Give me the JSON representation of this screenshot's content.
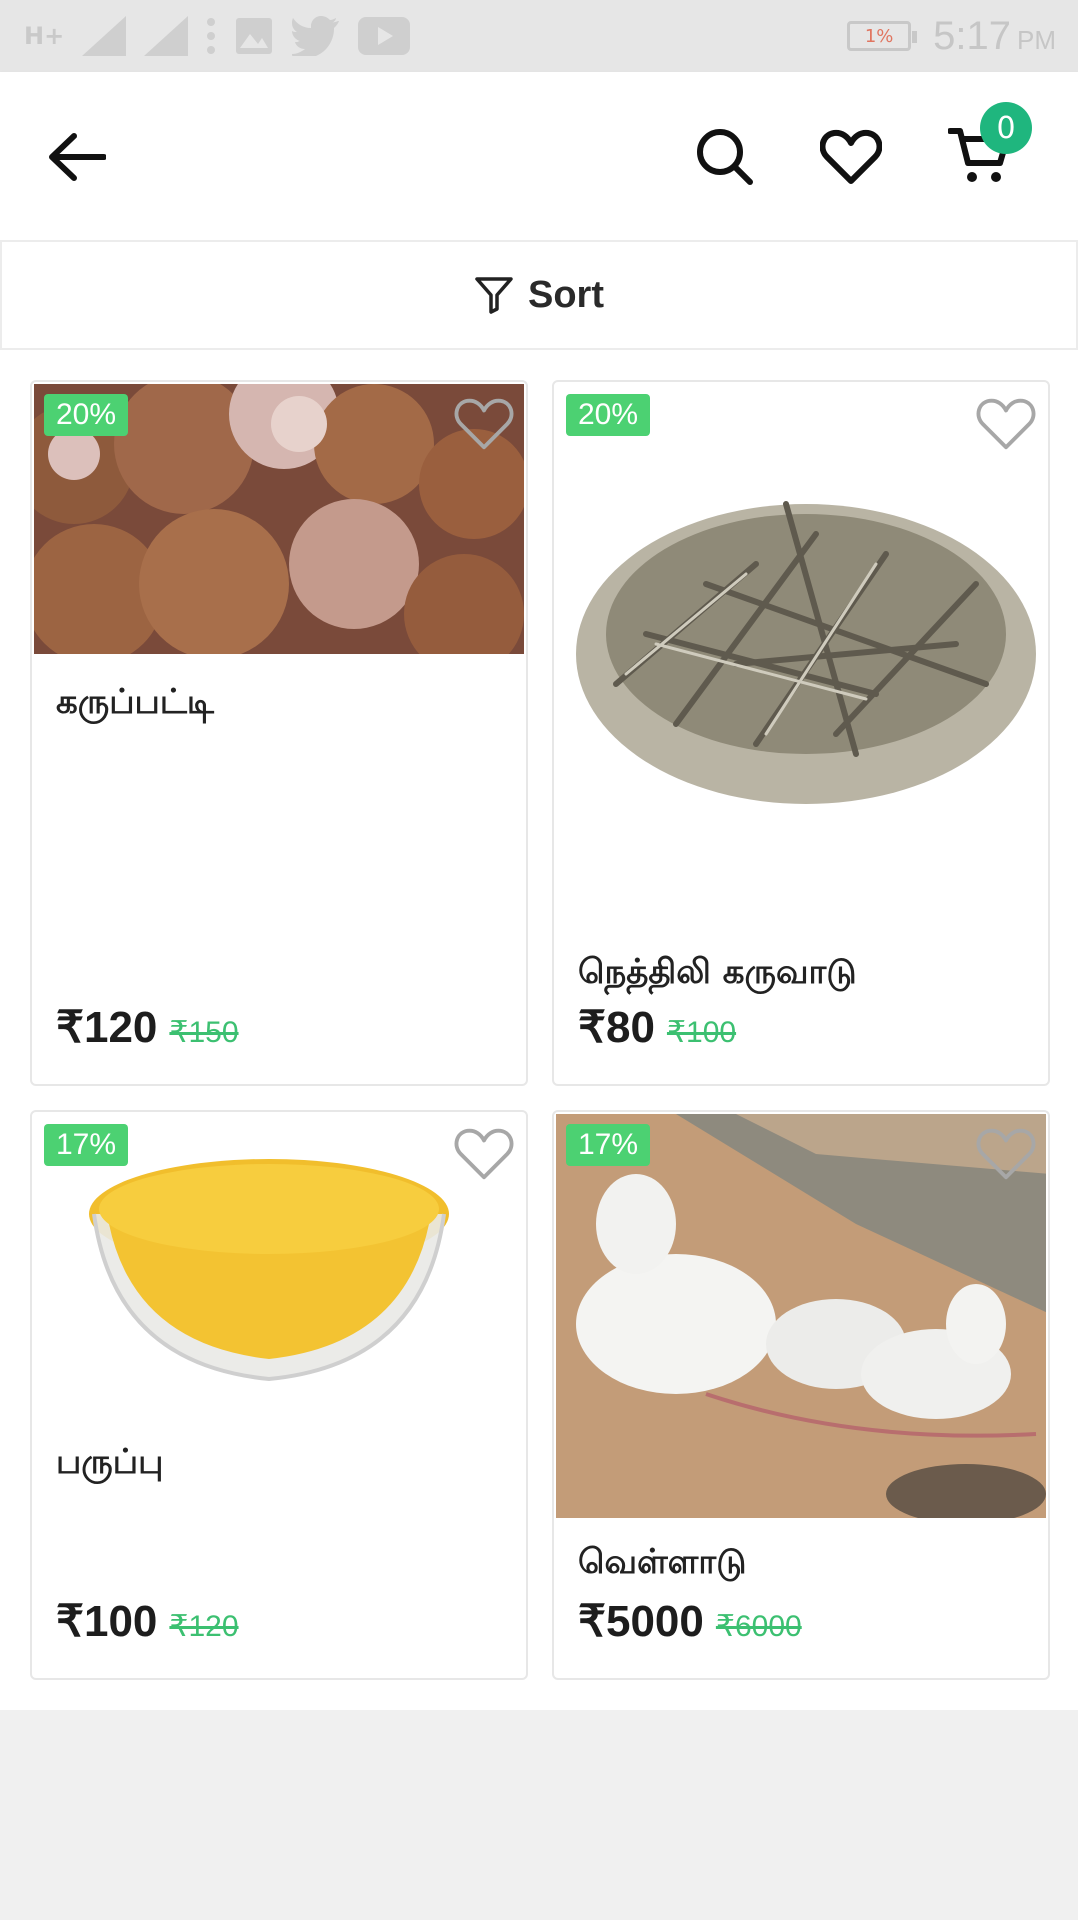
{
  "status_bar": {
    "network": "H+",
    "battery": "1%",
    "time": "5:17",
    "ampm": "PM"
  },
  "header": {
    "cart_count": "0"
  },
  "sort": {
    "label": "Sort"
  },
  "products": [
    {
      "name": "கருப்பட்டி",
      "discount": "20%",
      "price": "₹120",
      "old_price": "₹150"
    },
    {
      "name": "நெத்திலி கருவாடு",
      "discount": "20%",
      "price": "₹80",
      "old_price": "₹100"
    },
    {
      "name": "பருப்பு",
      "discount": "17%",
      "price": "₹100",
      "old_price": "₹120"
    },
    {
      "name": "வெள்ளாடு",
      "discount": "17%",
      "price": "₹5000",
      "old_price": "₹6000"
    }
  ]
}
